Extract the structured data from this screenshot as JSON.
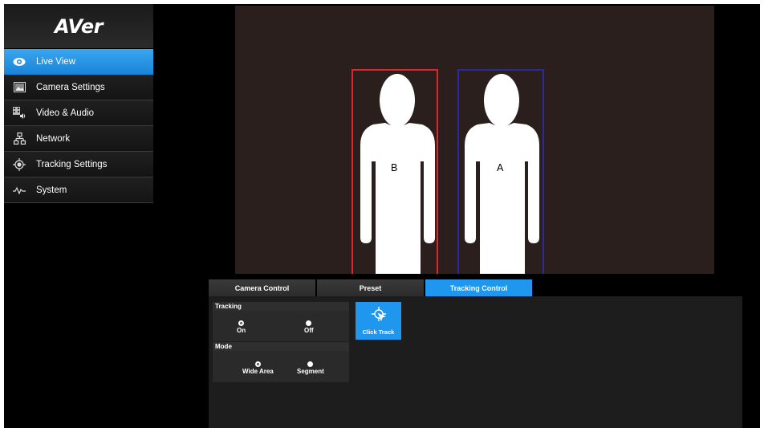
{
  "brand": {
    "logo": "AVer"
  },
  "sidebar": {
    "items": [
      {
        "label": "Live View",
        "icon": "eye-icon",
        "active": true
      },
      {
        "label": "Camera Settings",
        "icon": "image-icon",
        "active": false
      },
      {
        "label": "Video & Audio",
        "icon": "film-audio-icon",
        "active": false
      },
      {
        "label": "Network",
        "icon": "network-icon",
        "active": false
      },
      {
        "label": "Tracking Settings",
        "icon": "target-icon",
        "active": false
      },
      {
        "label": "System",
        "icon": "pulse-icon",
        "active": false
      }
    ]
  },
  "video": {
    "persons": [
      {
        "label": "B",
        "box_color": "#e0242b"
      },
      {
        "label": "A",
        "box_color": "#2a2a9a"
      }
    ]
  },
  "tabs": [
    {
      "label": "Camera Control",
      "active": false
    },
    {
      "label": "Preset",
      "active": false
    },
    {
      "label": "Tracking Control",
      "active": true
    }
  ],
  "tracking_control": {
    "tracking": {
      "title": "Tracking",
      "options": [
        "On",
        "Off"
      ],
      "selected": "On"
    },
    "mode": {
      "title": "Mode",
      "options": [
        "Wide Area",
        "Segment"
      ],
      "selected": "Wide Area"
    },
    "click_track": {
      "label": "Click Track",
      "icon": "click-target-icon"
    }
  },
  "colors": {
    "accent": "#1f97ef",
    "background": "#000000",
    "video_bg": "#2a1f1d"
  }
}
